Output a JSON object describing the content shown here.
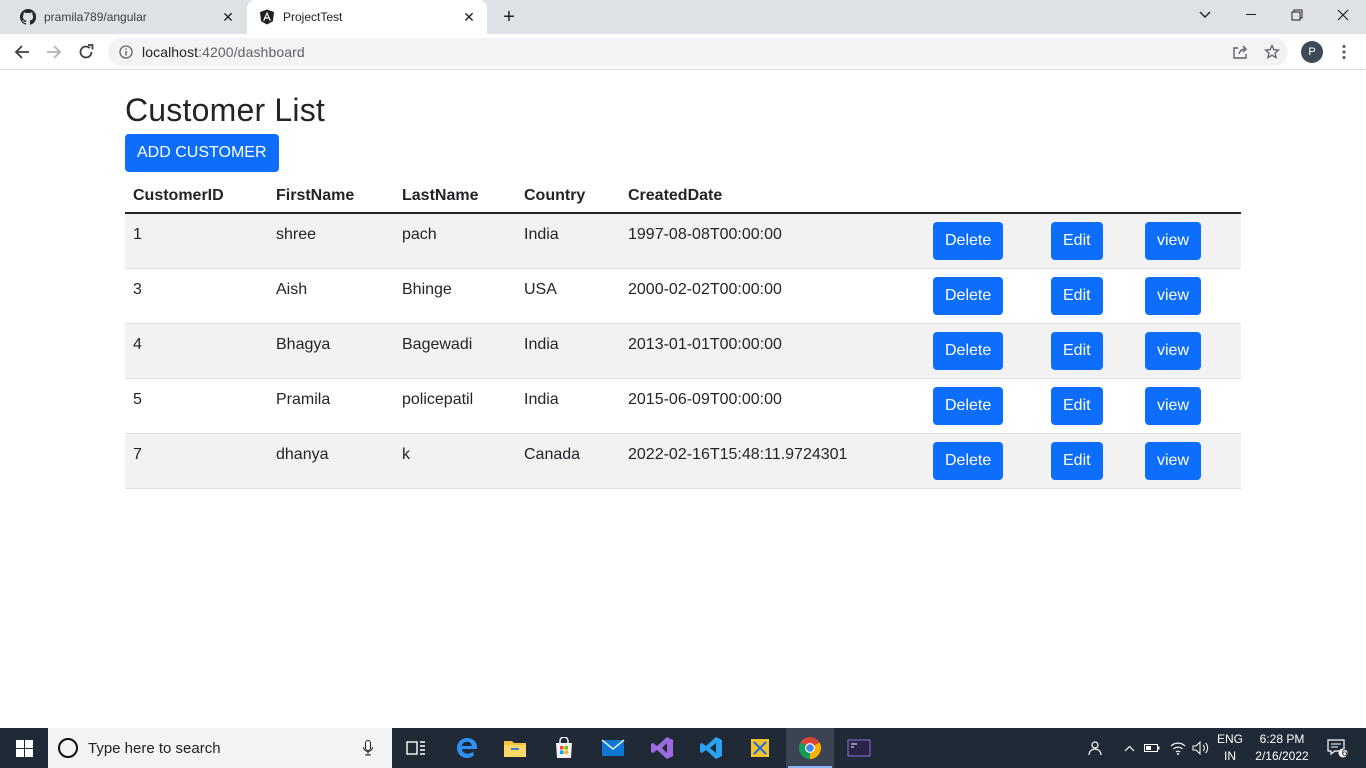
{
  "browser": {
    "tabs": [
      {
        "title": "pramila789/angular",
        "favicon": "github-icon",
        "active": false
      },
      {
        "title": "ProjectTest",
        "favicon": "angular-icon",
        "active": true
      }
    ],
    "url_host": "localhost",
    "url_rest": ":4200/dashboard",
    "profile_initial": "P"
  },
  "page": {
    "title": "Customer List",
    "add_button_label": "ADD CUSTOMER",
    "columns": [
      "CustomerID",
      "FirstName",
      "LastName",
      "Country",
      "CreatedDate"
    ],
    "action_labels": {
      "delete": "Delete",
      "edit": "Edit",
      "view": "view"
    },
    "customers": [
      {
        "id": "1",
        "first": "shree",
        "last": "pach",
        "country": "India",
        "created": "1997-08-08T00:00:00"
      },
      {
        "id": "3",
        "first": "Aish",
        "last": "Bhinge",
        "country": "USA",
        "created": "2000-02-02T00:00:00"
      },
      {
        "id": "4",
        "first": "Bhagya",
        "last": "Bagewadi",
        "country": "India",
        "created": "2013-01-01T00:00:00"
      },
      {
        "id": "5",
        "first": "Pramila",
        "last": "policepatil",
        "country": "India",
        "created": "2015-06-09T00:00:00"
      },
      {
        "id": "7",
        "first": "dhanya",
        "last": "k",
        "country": "Canada",
        "created": "2022-02-16T15:48:11.9724301"
      }
    ],
    "colors": {
      "primary": "#0d6efd",
      "stripe": "#f2f2f2",
      "text": "#212529"
    }
  },
  "taskbar": {
    "search_placeholder": "Type here to search",
    "lang_top": "ENG",
    "lang_bottom": "IN",
    "time": "6:28 PM",
    "date": "2/16/2022",
    "notifications": "6"
  }
}
